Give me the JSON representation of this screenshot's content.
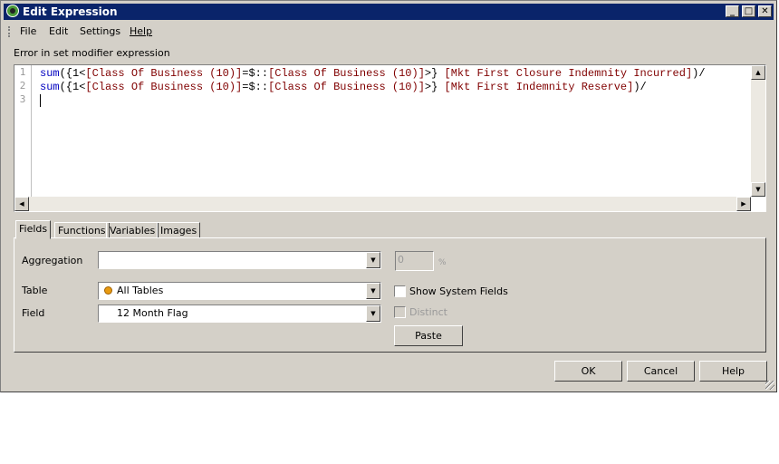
{
  "window": {
    "title": "Edit Expression",
    "controls": [
      "_",
      "□",
      "✕"
    ]
  },
  "menu": [
    "File",
    "Edit",
    "Settings",
    "Help"
  ],
  "error_message": "Error in set modifier expression",
  "editor": {
    "line_numbers": [
      "1",
      "2",
      "3"
    ],
    "lines": [
      [
        {
          "text": "sum",
          "color": "#0000c0"
        },
        {
          "text": "({1<",
          "color": "#000000"
        },
        {
          "text": "[Class Of Business (10)]",
          "color": "#800000"
        },
        {
          "text": "=$::",
          "color": "#000000"
        },
        {
          "text": "[Class Of Business (10)]",
          "color": "#800000"
        },
        {
          "text": ">} ",
          "color": "#000000"
        },
        {
          "text": "[Mkt First Closure Indemnity Incurred]",
          "color": "#800000"
        },
        {
          "text": ")/",
          "color": "#000000"
        }
      ],
      [
        {
          "text": "sum",
          "color": "#0000c0"
        },
        {
          "text": "({1<",
          "color": "#000000"
        },
        {
          "text": "[Class Of Business (10)]",
          "color": "#800000"
        },
        {
          "text": "=$::",
          "color": "#000000"
        },
        {
          "text": "[Class Of Business (10)]",
          "color": "#800000"
        },
        {
          "text": ">} ",
          "color": "#000000"
        },
        {
          "text": "[Mkt First Indemnity Reserve]",
          "color": "#800000"
        },
        {
          "text": ")/",
          "color": "#000000"
        }
      ],
      []
    ]
  },
  "tabs": [
    "Fields",
    "Functions",
    "Variables",
    "Images"
  ],
  "fields": {
    "aggregation_label": "Aggregation",
    "aggregation_value": "",
    "percent_value": "0",
    "percent_sign": "%",
    "table_label": "Table",
    "table_value": "All Tables",
    "field_label": "Field",
    "field_value": "12 Month Flag",
    "show_system_fields": "Show System Fields",
    "distinct": "Distinct",
    "paste": "Paste"
  },
  "buttons": {
    "ok": "OK",
    "cancel": "Cancel",
    "help": "Help"
  }
}
